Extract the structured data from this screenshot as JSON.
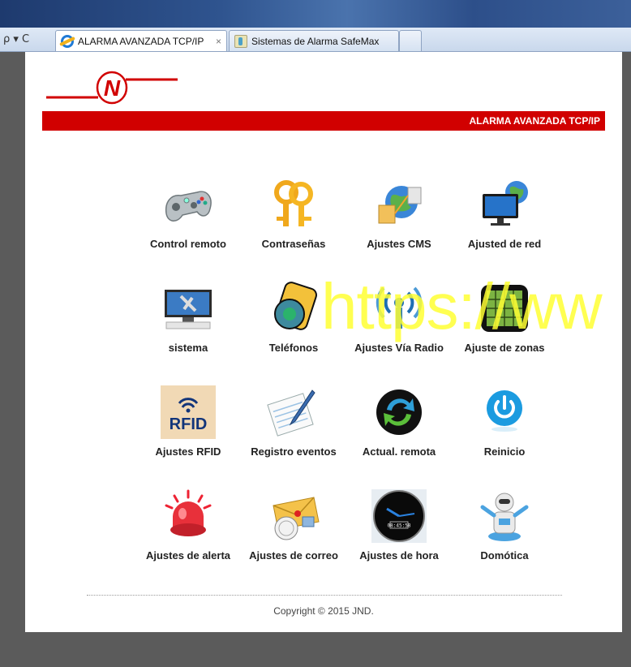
{
  "browser": {
    "address_controls": "ρ ▾ C",
    "tabs": [
      {
        "title": "ALARMA AVANZADA TCP/IP",
        "close": "×"
      },
      {
        "title": "Sistemas de Alarma SafeMax"
      }
    ]
  },
  "header": {
    "logo_letter": "N",
    "banner_title": "ALARMA AVANZADA TCP/IP",
    "brand_color": "#d10000"
  },
  "menu": [
    {
      "label": "Control remoto",
      "icon": "gamepad-icon"
    },
    {
      "label": "Contraseñas",
      "icon": "keys-icon"
    },
    {
      "label": "Ajustes CMS",
      "icon": "network-globe-icon"
    },
    {
      "label": "Ajusted de red",
      "icon": "monitor-globe-icon"
    },
    {
      "label": "sistema",
      "icon": "computer-tools-icon"
    },
    {
      "label": "Teléfonos",
      "icon": "phone-icon"
    },
    {
      "label": "Ajustes Vía Radio",
      "icon": "radio-signal-icon"
    },
    {
      "label": "Ajuste de zonas",
      "icon": "zone-keypad-icon"
    },
    {
      "label": "Ajustes RFID",
      "icon": "rfid-icon",
      "icon_text": "RFID"
    },
    {
      "label": "Registro eventos",
      "icon": "notepad-pen-icon"
    },
    {
      "label": "Actual. remota",
      "icon": "refresh-icon"
    },
    {
      "label": "Reinicio",
      "icon": "power-icon"
    },
    {
      "label": "Ajustes de alerta",
      "icon": "alarm-light-icon"
    },
    {
      "label": "Ajustes de correo",
      "icon": "mail-icon"
    },
    {
      "label": "Ajustes de hora",
      "icon": "clock-icon",
      "icon_text": "08:45:58"
    },
    {
      "label": "Domótica",
      "icon": "robot-icon"
    }
  ],
  "watermark": "https://ww",
  "footer": {
    "copyright": "Copyright © 2015 JND."
  }
}
